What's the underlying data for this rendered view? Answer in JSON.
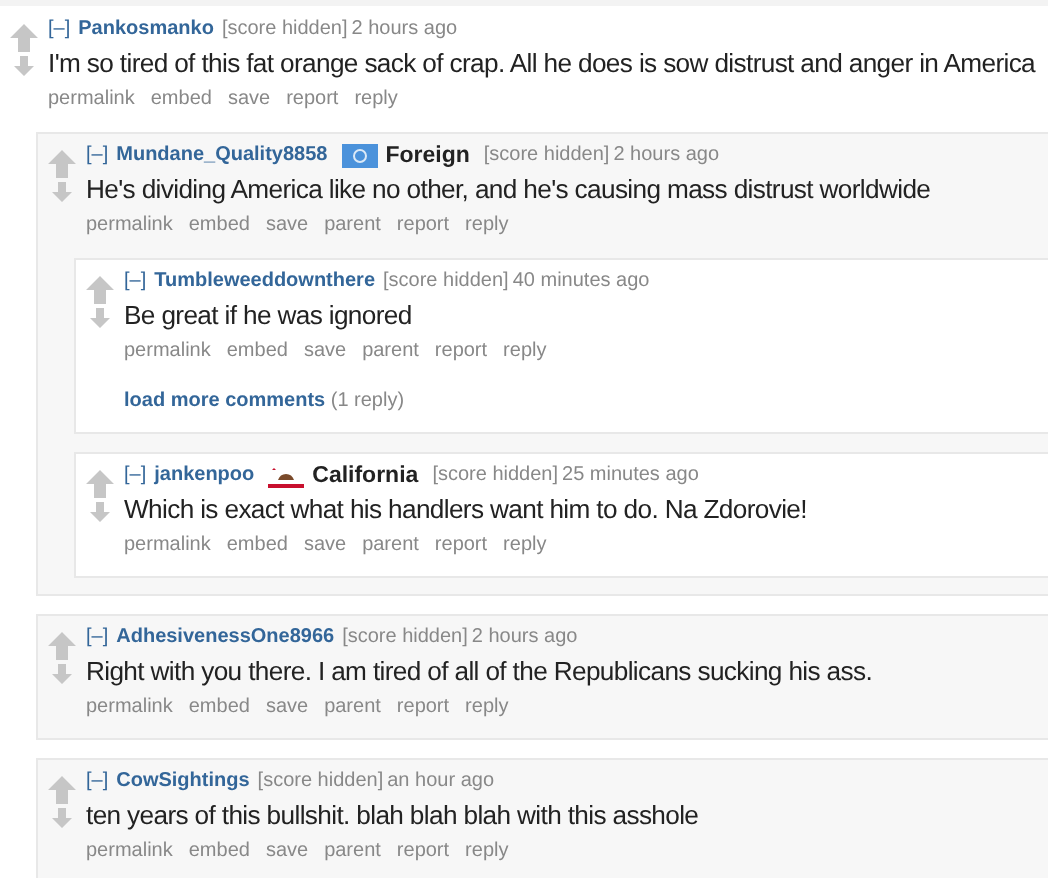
{
  "comments": [
    {
      "toggle": "[–]",
      "author": "Pankosmanko",
      "score": "[score hidden]",
      "time": "2 hours ago",
      "body": "I'm so tired of this fat orange sack of crap. All he does is sow distrust and anger in America",
      "buttons": [
        "permalink",
        "embed",
        "save",
        "report",
        "reply"
      ],
      "children": [
        {
          "toggle": "[–]",
          "author": "Mundane_Quality8858",
          "flair": {
            "kind": "blue-flag",
            "text": "Foreign"
          },
          "score": "[score hidden]",
          "time": "2 hours ago",
          "body": "He's dividing America like no other, and he's causing mass distrust worldwide",
          "buttons": [
            "permalink",
            "embed",
            "save",
            "parent",
            "report",
            "reply"
          ],
          "children": [
            {
              "toggle": "[–]",
              "author": "Tumbleweeddownthere",
              "score": "[score hidden]",
              "time": "40 minutes ago",
              "body": "Be great if he was ignored",
              "buttons": [
                "permalink",
                "embed",
                "save",
                "parent",
                "report",
                "reply"
              ],
              "load_more": {
                "link": "load more comments",
                "count": "(1 reply)"
              }
            },
            {
              "toggle": "[–]",
              "author": "jankenpoo",
              "flair": {
                "kind": "bear-flag",
                "text": "California"
              },
              "score": "[score hidden]",
              "time": "25 minutes ago",
              "body": "Which is exact what his handlers want him to do. Na Zdorovie!",
              "buttons": [
                "permalink",
                "embed",
                "save",
                "parent",
                "report",
                "reply"
              ]
            }
          ]
        },
        {
          "toggle": "[–]",
          "author": "AdhesivenessOne8966",
          "score": "[score hidden]",
          "time": "2 hours ago",
          "body": "Right with you there. I am tired of all of the Republicans sucking his ass.",
          "buttons": [
            "permalink",
            "embed",
            "save",
            "parent",
            "report",
            "reply"
          ]
        },
        {
          "toggle": "[–]",
          "author": "CowSightings",
          "score": "[score hidden]",
          "time": "an hour ago",
          "body": "ten years of this bullshit. blah blah blah with this asshole",
          "buttons": [
            "permalink",
            "embed",
            "save",
            "parent",
            "report",
            "reply"
          ]
        }
      ]
    }
  ]
}
